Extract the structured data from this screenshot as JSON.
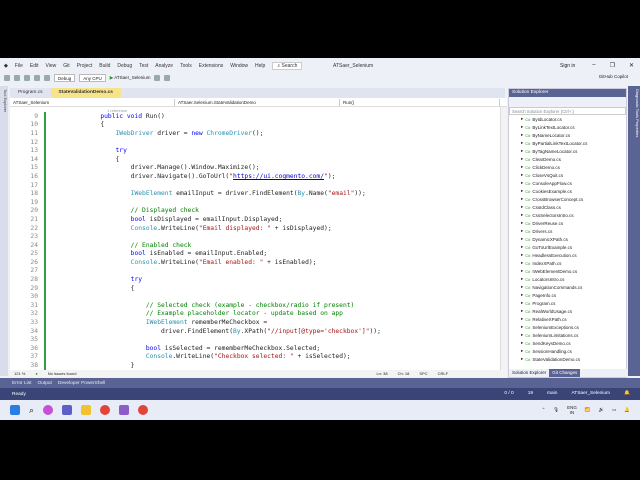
{
  "menu": [
    "File",
    "Edit",
    "View",
    "Git",
    "Project",
    "Build",
    "Debug",
    "Test",
    "Analyze",
    "Tools",
    "Extensions",
    "Window",
    "Help"
  ],
  "search_label": "Search",
  "window_title": "ATSaer_Selenium",
  "sign_in": "Sign in",
  "toolbar": {
    "config": "Debug",
    "platform": "Any CPU",
    "run_target": "ATSaer_Selenium",
    "copilot": "GitHub Copilot"
  },
  "left_strip": "Tool Explorer",
  "right_strip": "Diagnostic Tools  Properties",
  "tabs": [
    {
      "label": "Program.cs"
    },
    {
      "label": "StateValidationDemo.cs"
    }
  ],
  "navbar": {
    "project": "ATSaer_Selenium",
    "class": "ATSaer.Selenium.StateValidationDemo",
    "member": "Run()"
  },
  "codelens": "1 reference",
  "code": [
    {
      "n": "9",
      "t": "        <span class='kw'>public void</span> Run()"
    },
    {
      "n": "10",
      "t": "        {"
    },
    {
      "n": "11",
      "t": "            <span class='ty'>IWebDriver</span> driver = <span class='kw'>new</span> <span class='ty'>ChromeDriver</span>();"
    },
    {
      "n": "12",
      "t": ""
    },
    {
      "n": "13",
      "t": "            <span class='kw'>try</span>"
    },
    {
      "n": "14",
      "t": "            {"
    },
    {
      "n": "15",
      "t": "                driver.Manage().Window.Maximize();"
    },
    {
      "n": "16",
      "t": "                driver.Navigate().GoToUrl(<span class='st'>\"<span class='url'>https://ui.cogmento.com/</span>\"</span>);"
    },
    {
      "n": "17",
      "t": ""
    },
    {
      "n": "18",
      "t": "                <span class='ty'>IWebElement</span> emailInput = driver.FindElement(<span class='ty'>By</span>.Name(<span class='st'>\"email\"</span>));"
    },
    {
      "n": "19",
      "t": ""
    },
    {
      "n": "20",
      "t": "                <span class='cm'>// Displayed check</span>"
    },
    {
      "n": "21",
      "t": "                <span class='kw'>bool</span> isDisplayed = emailInput.Displayed;"
    },
    {
      "n": "22",
      "t": "                <span class='ty'>Console</span>.WriteLine(<span class='st'>\"Email displayed: \"</span> + isDisplayed);"
    },
    {
      "n": "23",
      "t": ""
    },
    {
      "n": "24",
      "t": "                <span class='cm'>// Enabled check</span>"
    },
    {
      "n": "25",
      "t": "                <span class='kw'>bool</span> isEnabled = emailInput.Enabled;"
    },
    {
      "n": "26",
      "t": "                <span class='ty'>Console</span>.WriteLine(<span class='st'>\"Email enabled: \"</span> + isEnabled);"
    },
    {
      "n": "27",
      "t": ""
    },
    {
      "n": "28",
      "t": "                <span class='kw'>try</span>"
    },
    {
      "n": "29",
      "t": "                {"
    },
    {
      "n": "30",
      "t": ""
    },
    {
      "n": "31",
      "t": "                    <span class='cm'>// Selected check (example - checkbox/radio if present)</span>"
    },
    {
      "n": "32",
      "t": "                    <span class='cm'>// Example placeholder locator - update based on app</span>"
    },
    {
      "n": "33",
      "t": "                    <span class='ty'>IWebElement</span> rememberMeCheckbox ="
    },
    {
      "n": "34",
      "t": "                        driver.FindElement(<span class='ty'>By</span>.XPath(<span class='st'>\"//input[@type='checkbox']\"</span>));"
    },
    {
      "n": "35",
      "t": ""
    },
    {
      "n": "36",
      "t": "                    <span class='kw'>bool</span> isSelected = rememberMeCheckbox.Selected;"
    },
    {
      "n": "37",
      "t": "                    <span class='ty'>Console</span>.WriteLine(<span class='st'>\"Checkbox selected: \"</span> + isSelected);"
    },
    {
      "n": "38",
      "t": "                }"
    }
  ],
  "editor_status": {
    "zoom": "121 %",
    "issues": "No issues found",
    "ln": "Ln: 38",
    "ch": "Ch: 18",
    "spc": "SPC",
    "crlf": "CRLF"
  },
  "bottom_tabs": [
    "Error List",
    "Output",
    "Developer PowerShell"
  ],
  "status": {
    "ready": "Ready",
    "updown": "0 / 0",
    "edits": "19",
    "branch": "main",
    "repo": "ATSaer_Selenium"
  },
  "solution_explorer": {
    "title": "Solution Explorer",
    "search_placeholder": "Search Solution Explorer (Ctrl+;)",
    "items": [
      "ByIdLocator.cs",
      "ByLinkTextLocator.cs",
      "ByNameLocator.cs",
      "ByPartialLinkTextLocator.cs",
      "ByTagNameLocator.cs",
      "ClearDemo.cs",
      "ClickDemo.cs",
      "CloseVsQuit.cs",
      "ConsoleAppFlow.cs",
      "CookiesExample.cs",
      "CrossBrowserConcept.cs",
      "CssIdClass.cs",
      "CssSelectorsIntro.cs",
      "DriverReuse.cs",
      "Drivers.cs",
      "DynamicXPath.cs",
      "GoToUrlExample.cs",
      "HeadlessExecution.cs",
      "IndexXPath.cs",
      "IWebElementDemo.cs",
      "LocatorsIntro.cs",
      "NavigationCommands.cs",
      "PageInfo.cs",
      "Program.cs",
      "RealWorldUsage.cs",
      "RelativeXPath.cs",
      "SeleniumExceptions.cs",
      "SeleniumLimitations.cs",
      "SendKeysDemo.cs",
      "SessionHandling.cs",
      "StateValidationDemo.cs"
    ],
    "tabs": [
      "Solution Explorer",
      "Git Changes"
    ]
  },
  "tray": {
    "lang": "ENG",
    "region": "IN"
  }
}
